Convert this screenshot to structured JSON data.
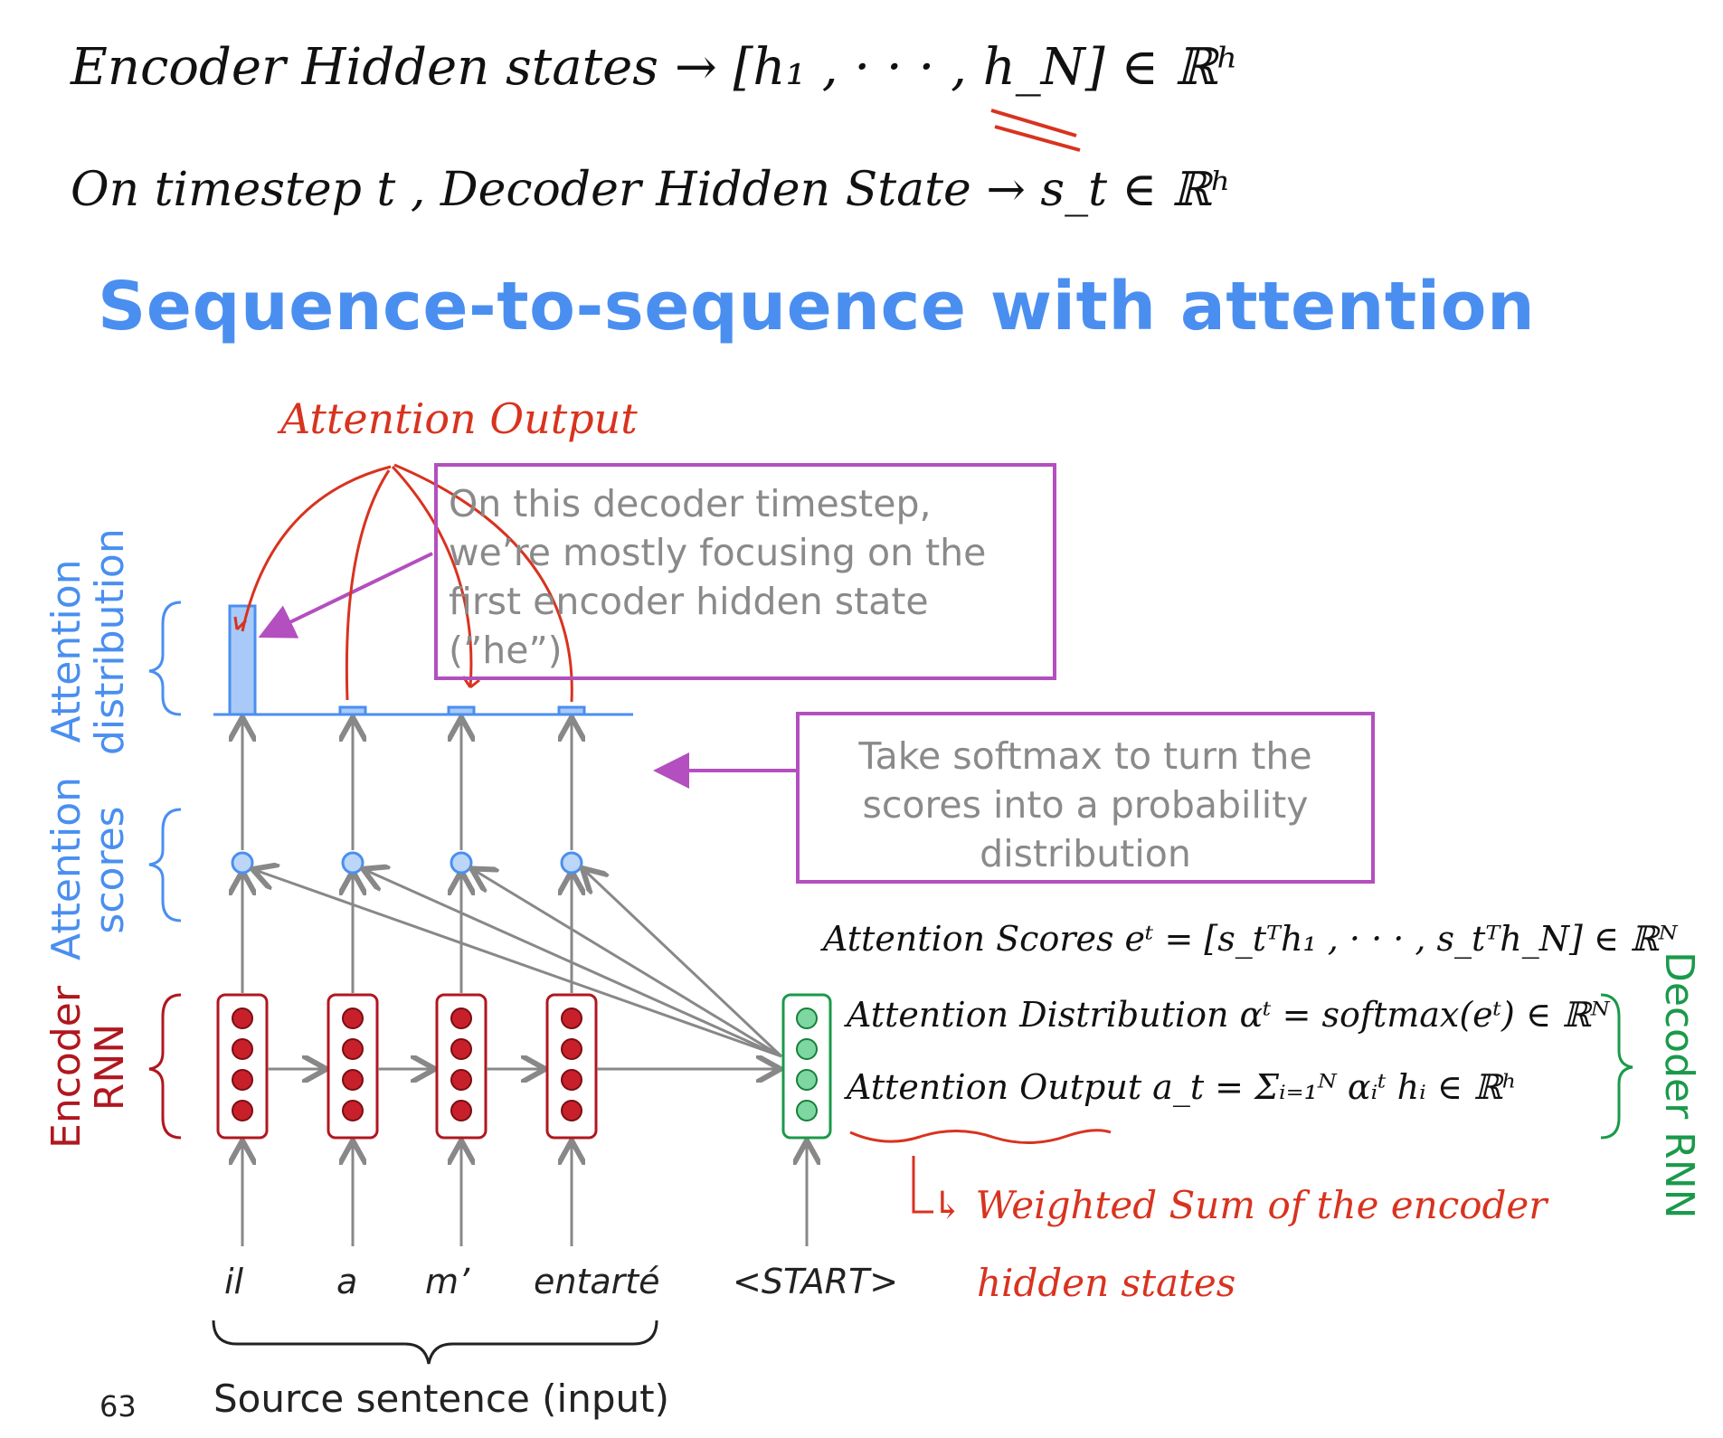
{
  "handwritten_top": {
    "line1": "Encoder Hidden states → [h₁ , · · · , h_N] ∈ ℝʰ",
    "line2": "On timestep t , Decoder Hidden State → s_t ∈ ℝʰ"
  },
  "slide": {
    "title": "Sequence-to-sequence with attention",
    "page_number": "63",
    "callout_focus": "On this decoder timestep, we’re mostly focusing on the first encoder hidden state (”he”)",
    "callout_softmax": "Take softmax to turn the scores into a probability distribution",
    "labels": {
      "attention_distribution": [
        "Attention",
        "distribution"
      ],
      "attention_scores": [
        "Attention",
        "scores"
      ],
      "encoder_rnn": [
        "Encoder",
        "RNN"
      ],
      "decoder_rnn": "Decoder RNN"
    },
    "source_words": [
      "il",
      "a",
      "m’",
      "entarté"
    ],
    "decoder_input": "<START>",
    "source_caption": "Source sentence (input)",
    "attention_distribution_values": [
      0.76,
      0.04,
      0.04,
      0.04
    ]
  },
  "handwritten_notes": {
    "attention_output_label": "Attention Output",
    "scores_eq": "Attention Scores  eᵗ = [s_tᵀh₁ , · · · , s_tᵀh_N] ∈ ℝᴺ",
    "distribution_eq": "Attention Distribution  αᵗ = softmax(eᵗ) ∈ ℝᴺ",
    "output_eq": "Attention Output  a_t = Σᵢ₌₁ᴺ αᵢᵗ hᵢ ∈ ℝʰ",
    "weighted_sum": "↳ Weighted Sum of the encoder",
    "weighted_sum_2": "hidden states"
  },
  "colors": {
    "title": "#4a8ff0",
    "attention_blue": "#4a8ff0",
    "encoder_red": "#b0171f",
    "decoder_green": "#1a9a4a",
    "callout_border": "#b34fbf",
    "annotation_red": "#d8331f",
    "ink_black": "#111111"
  }
}
